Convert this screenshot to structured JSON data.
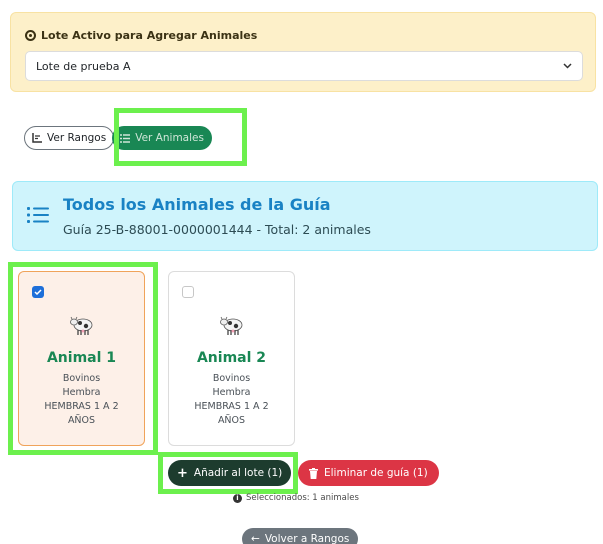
{
  "lot_panel": {
    "title": "Lote Activo para Agregar Animales",
    "selected_value": "Lote de prueba A"
  },
  "view_toggle": {
    "ranges_label": "Ver Rangos",
    "animals_label": "Ver Animales"
  },
  "banner": {
    "title": "Todos los Animales de la Guía",
    "subtitle": "Guía 25-B-88001-0000001444 - Total: 2 animales"
  },
  "animals": [
    {
      "name": "Animal 1",
      "species": "Bovinos",
      "sex": "Hembra",
      "category_line1": "HEMBRAS 1 A 2",
      "category_line2": "AÑOS",
      "checked": true
    },
    {
      "name": "Animal 2",
      "species": "Bovinos",
      "sex": "Hembra",
      "category_line1": "HEMBRAS 1 A 2",
      "category_line2": "AÑOS",
      "checked": false
    }
  ],
  "actions": {
    "add_label": "Añadir al lote (1)",
    "delete_label": "Eliminar de guía (1)",
    "selected_info": "Seleccionados: 1 animales",
    "back_label": "Volver a Rangos"
  },
  "colors": {
    "primary_green": "#198754",
    "danger_red": "#dc3545",
    "highlight": "#6cf04d",
    "warning_bg": "#fdf0c9",
    "info_bg": "#cff4fc"
  },
  "icons": [
    "target-icon",
    "chevron-down-icon",
    "chart-icon",
    "list-icon",
    "cow-icon",
    "plus-icon",
    "trash-icon",
    "info-icon",
    "arrow-left-icon"
  ]
}
